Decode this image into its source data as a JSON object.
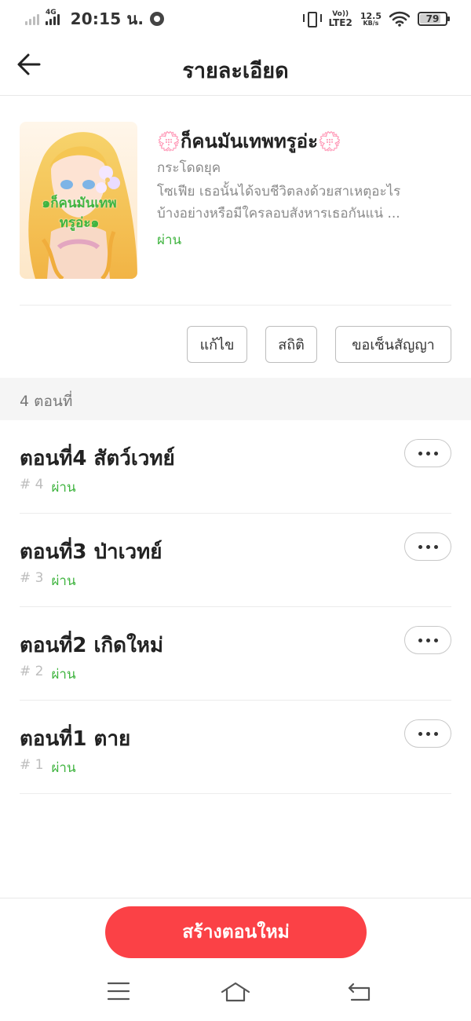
{
  "status_bar": {
    "network_type": "4G",
    "time": "20:15 น.",
    "volte_top": "Vo))",
    "volte_bottom": "LTE2",
    "speed_value": "12.5",
    "speed_unit": "KB/s",
    "battery_level": "79"
  },
  "header": {
    "title": "รายละเอียด"
  },
  "story": {
    "cover_caption_line1": "๑ก็คนมันเทพ",
    "cover_caption_line2": "ทรูอ่ะ๑",
    "title": "💮ก็คนมันเทพทรูอ่ะ💮",
    "genre": "กระโดดยุค",
    "description_line1": "โซเฟีย เธอนั้นได้จบชีวิตลงด้วยสาเหตุอะไร",
    "description_line2": "บ้างอย่างหรือมีใครลอบสังหารเธอกันแน่ ...",
    "status": "ผ่าน"
  },
  "actions": {
    "edit_label": "แก้ไข",
    "stats_label": "สถิติ",
    "contract_label": "ขอเซ็นสัญญา"
  },
  "episodes_header": "4 ตอนที่",
  "episodes": [
    {
      "title": "ตอนที่4 สัตว์เวทย์",
      "number": "# 4",
      "status": "ผ่าน"
    },
    {
      "title": "ตอนที่3 ป่าเวทย์",
      "number": "# 3",
      "status": "ผ่าน"
    },
    {
      "title": "ตอนที่2 เกิดใหม่",
      "number": "# 2",
      "status": "ผ่าน"
    },
    {
      "title": "ตอนที่1 ตาย",
      "number": "# 1",
      "status": "ผ่าน"
    }
  ],
  "bottom": {
    "create_label": "สร้างตอนใหม่"
  },
  "icons": {
    "back": "arrow-left-icon",
    "more": "more-horizontal-icon",
    "nav_menu": "menu-icon",
    "nav_home": "home-icon",
    "nav_back": "return-icon"
  },
  "colors": {
    "accent": "#fb4146",
    "status_green": "#3fb43f"
  }
}
